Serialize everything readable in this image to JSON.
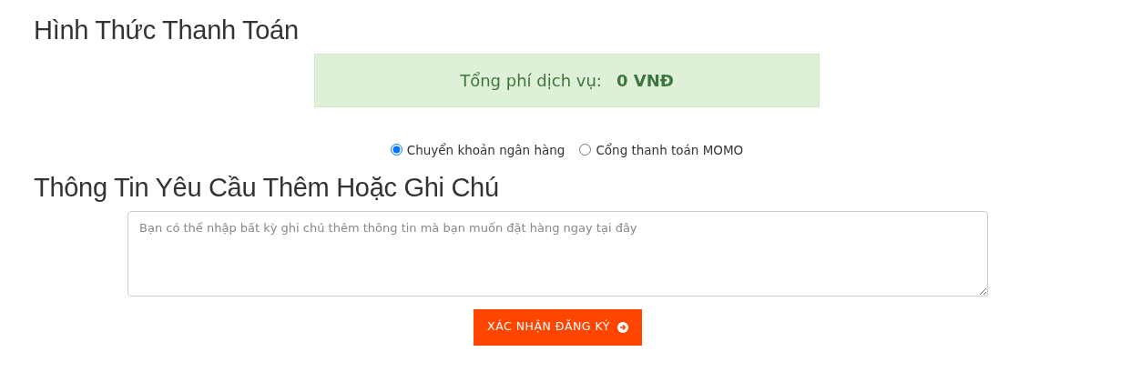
{
  "payment_heading": "Hình Thức Thanh Toán",
  "fee": {
    "label": "Tổng phí dịch vụ:",
    "amount": "0 VNĐ"
  },
  "payment_methods": [
    {
      "label": "Chuyển khoản ngân hàng",
      "selected": true
    },
    {
      "label": "Cổng thanh toán MOMO",
      "selected": false
    }
  ],
  "notes_heading": "Thông Tin Yêu Cầu Thêm Hoặc Ghi Chú",
  "notes_field": {
    "placeholder": "Bạn có thể nhập bất kỳ ghi chú thêm thông tin mà bạn muốn đặt hàng ngay tại đây"
  },
  "submit_button": "XÁC NHẬN ĐĂNG KÝ"
}
